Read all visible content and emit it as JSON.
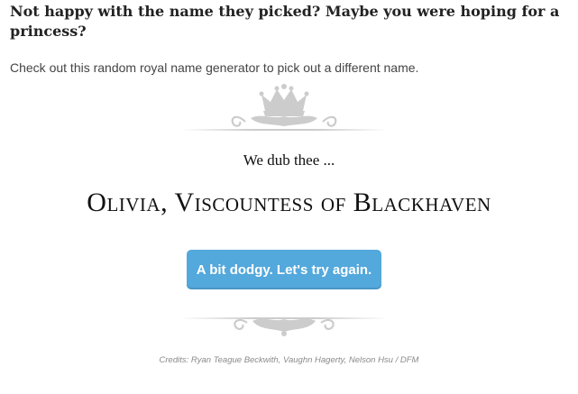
{
  "headline": "Not happy with the name they picked? Maybe you were hoping for a princess?",
  "intro": "Check out this random royal name generator to pick out a different name.",
  "generator": {
    "dub_text": "We dub thee ...",
    "royal_name": "Olivia, Viscountess of Blackhaven",
    "retry_button_label": "A bit dodgy. Let's try again.",
    "credits": "Credits: Ryan Teague Beckwith, Vaughn Hagerty, Nelson Hsu / DFM"
  },
  "icons": {
    "top_ornament": "crown-flourish-icon",
    "bottom_ornament": "scroll-flourish-icon"
  },
  "colors": {
    "button_bg": "#53a8dc",
    "button_text": "#ffffff",
    "ornament": "#c9c9c9",
    "credits_text": "#8a8a8a"
  }
}
